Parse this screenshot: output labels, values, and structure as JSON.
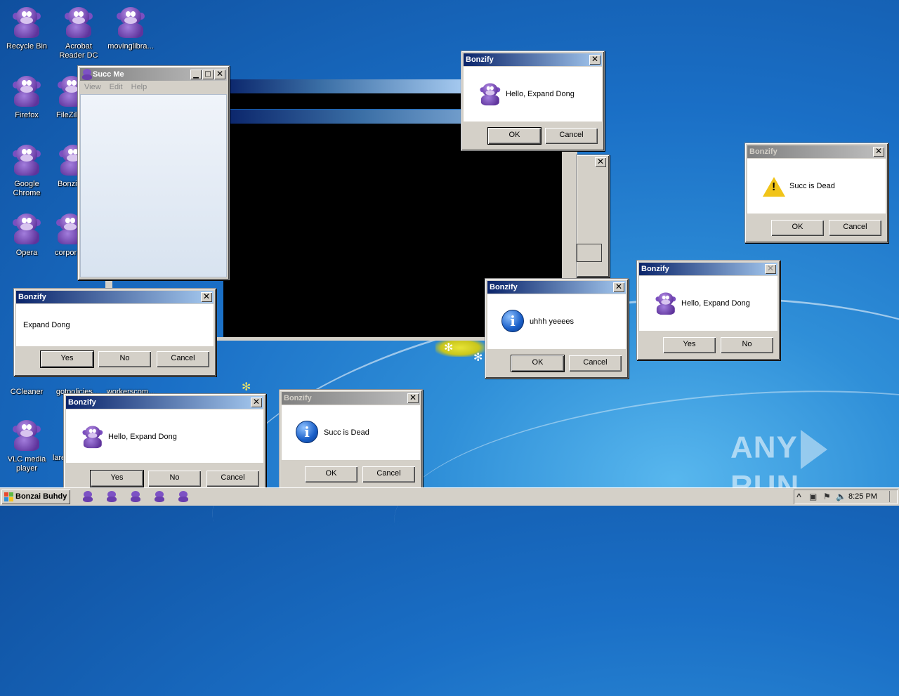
{
  "desktop": {
    "icons": [
      {
        "label": "Recycle Bin"
      },
      {
        "label": "Acrobat Reader DC"
      },
      {
        "label": "movinglibra..."
      },
      {
        "label": "Firefox"
      },
      {
        "label": "FileZilla"
      },
      {
        "label": "Google Chrome"
      },
      {
        "label": "Bonzify"
      },
      {
        "label": "Opera"
      },
      {
        "label": "corpor"
      },
      {
        "label": "CCleaner"
      },
      {
        "label": "gotpolicies...."
      },
      {
        "label": "workerscom..."
      },
      {
        "label": "VLC media player"
      },
      {
        "label": "lare"
      }
    ]
  },
  "succ_me": {
    "title": "Succ Me",
    "menu": [
      "View",
      "Edit",
      "Help"
    ]
  },
  "dialogs": {
    "d1": {
      "title": "Bonzify",
      "message": "Hello, Expand Dong",
      "ok": "OK",
      "cancel": "Cancel"
    },
    "d2": {
      "title": "Bonzify",
      "message": "Succ is Dead",
      "ok": "OK",
      "cancel": "Cancel"
    },
    "d3": {
      "title": "Bonzify",
      "message": "Hello, Expand Dong",
      "yes": "Yes",
      "no": "No"
    },
    "d4": {
      "title": "Bonzify",
      "message": "uhhh yeeees",
      "ok": "OK",
      "cancel": "Cancel"
    },
    "d5": {
      "title": "Bonzify",
      "message": "Expand Dong",
      "yes": "Yes",
      "no": "No",
      "cancel": "Cancel"
    },
    "d6": {
      "title": "Bonzify",
      "message": "Hello, Expand Dong",
      "yes": "Yes",
      "no": "No",
      "cancel": "Cancel"
    },
    "d7": {
      "title": "Bonzify",
      "message": "Succ is Dead",
      "ok": "OK",
      "cancel": "Cancel"
    }
  },
  "taskbar": {
    "start_label": "Bonzai Buhdy",
    "tray_arrow": "^",
    "clock": "8:25 PM"
  },
  "watermark": {
    "left": "ANY",
    "right": "RUN"
  },
  "colors": {
    "titlebar_active": "#0a246a",
    "titlebar_gradient_end": "#a6caf0",
    "window_face": "#d4d0c8"
  }
}
